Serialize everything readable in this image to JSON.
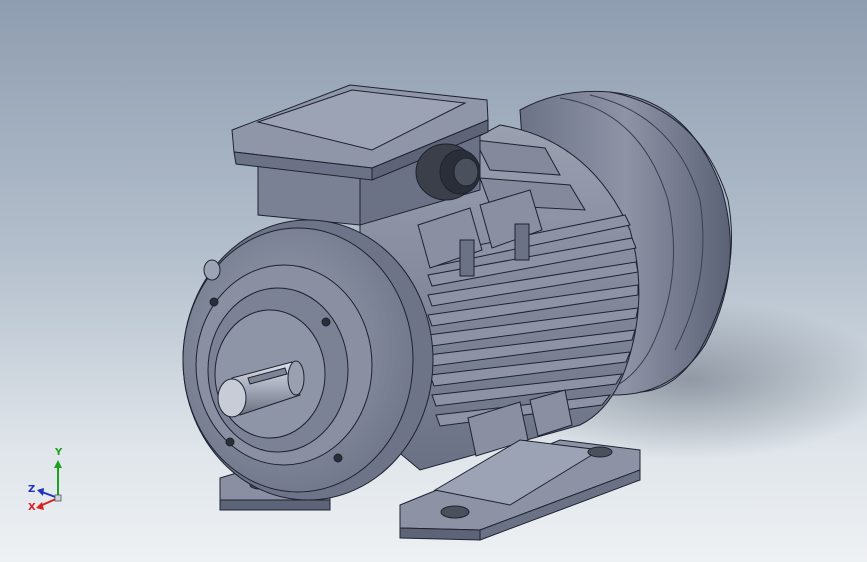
{
  "viewport": {
    "model_name": "",
    "background_top": "#8e9db0",
    "background_bottom": "#eef1f4"
  },
  "model": {
    "part_color": "#7d8597",
    "shade_dark": "#5a6072",
    "shade_light": "#a7adbd",
    "edge_color": "#1e2230"
  },
  "triad": {
    "x_label": "X",
    "y_label": "Y",
    "z_label": "Z",
    "x_color": "#d82020",
    "y_color": "#20a020",
    "z_color": "#2030c0"
  }
}
